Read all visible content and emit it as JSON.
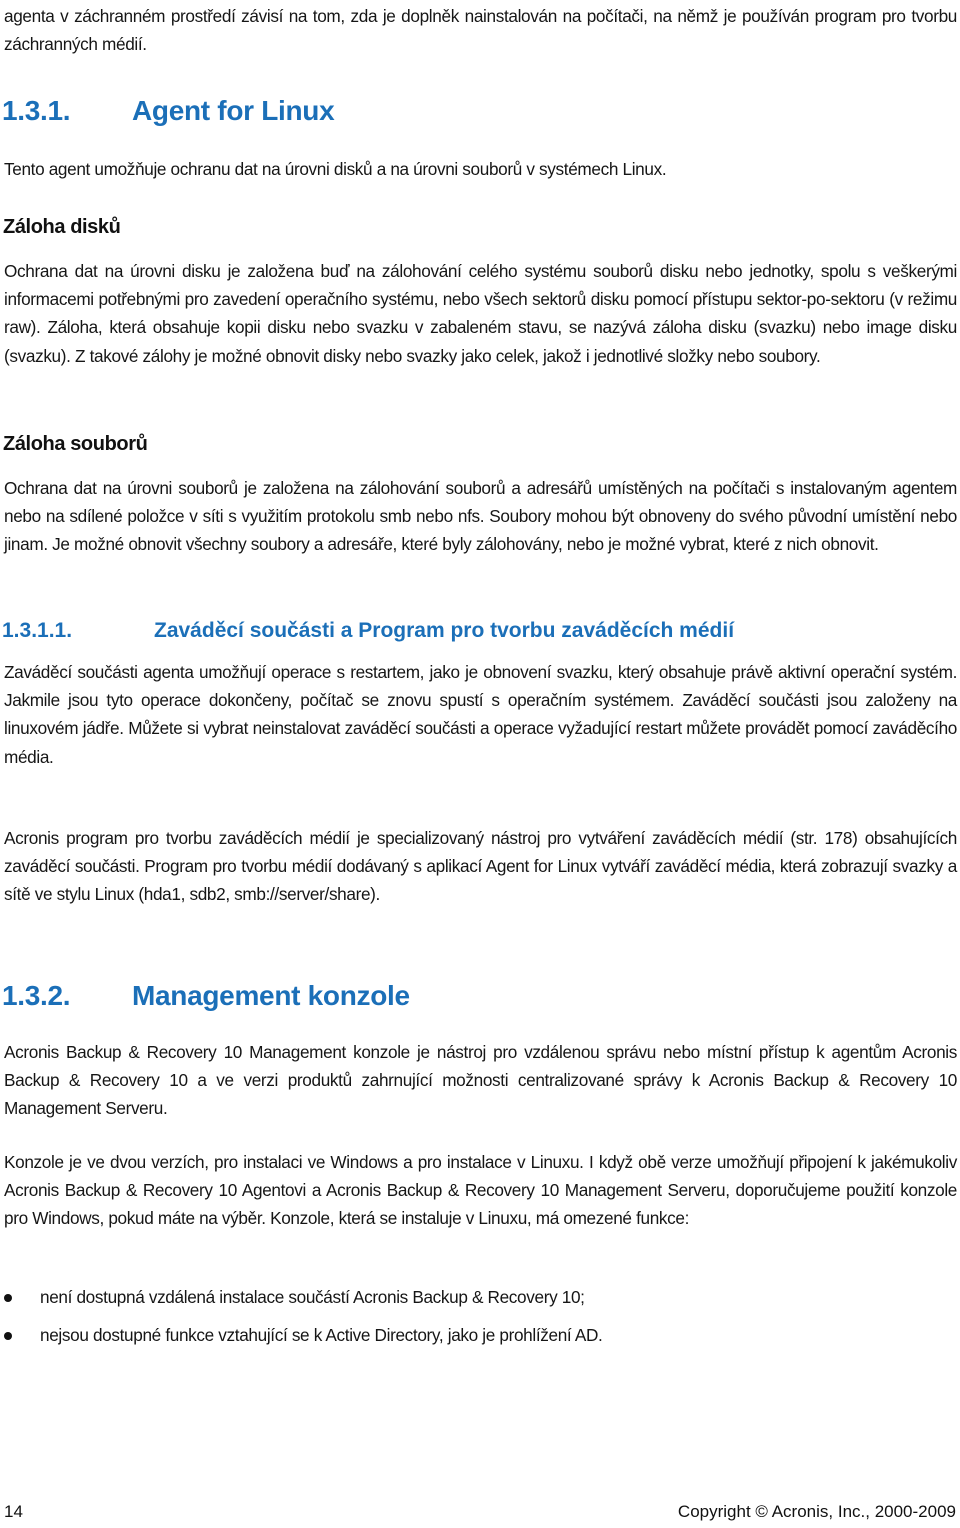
{
  "document": {
    "intro_paragraph": "agenta v záchranném prostředí závisí na tom, zda je doplněk nainstalován na počítači, na němž je používán program pro tvorbu záchranných médií.",
    "section_131": {
      "number": "1.3.1.",
      "title": "Agent for Linux",
      "intro": "Tento agent umožňuje ochranu dat na úrovni disků a na úrovni souborů v systémech Linux.",
      "disk_backup": {
        "heading": "Záloha disků",
        "text": "Ochrana dat na úrovni disku je založena buď na zálohování celého systému souborů disku nebo jednotky, spolu s veškerými informacemi potřebnými pro zavedení operačního systému, nebo všech sektorů disku pomocí přístupu sektor-po-sektoru (v režimu raw). Záloha, která obsahuje kopii disku nebo svazku v zabaleném stavu, se nazývá záloha disku (svazku) nebo image disku (svazku). Z takové zálohy je možné obnovit disky nebo svazky jako celek, jakož i jednotlivé složky nebo soubory."
      },
      "file_backup": {
        "heading": "Záloha souborů",
        "text": "Ochrana dat na úrovni souborů je založena na zálohování souborů a adresářů umístěných na počítači s instalovaným agentem nebo na sdílené položce v síti s využitím protokolu smb nebo nfs. Soubory mohou být obnoveny do svého původní umístění nebo jinam. Je možné obnovit všechny soubory a adresáře, které byly zálohovány, nebo je možné vybrat, které z nich obnovit."
      }
    },
    "section_1311": {
      "number": "1.3.1.1.",
      "title": "Zaváděcí součásti a Program pro tvorbu zaváděcích médií",
      "paragraph_1": "Zaváděcí součásti agenta umožňují operace s restartem, jako je obnovení svazku, který obsahuje právě aktivní operační systém. Jakmile jsou tyto operace dokončeny, počítač se znovu spustí s operačním systémem. Zaváděcí součásti jsou založeny na linuxovém jádře. Můžete si vybrat neinstalovat zaváděcí součásti a operace vyžadující restart můžete provádět pomocí zaváděcího média.",
      "paragraph_2": "Acronis program pro tvorbu zaváděcích médií je specializovaný nástroj pro vytváření zaváděcích médií (str.  178) obsahujících zaváděcí součásti. Program pro tvorbu médií dodávaný s aplikací Agent for Linux vytváří zaváděcí média, která zobrazují svazky a sítě ve stylu Linux (hda1, sdb2, smb://server/share)."
    },
    "section_132": {
      "number": "1.3.2.",
      "title": "Management konzole",
      "paragraph_1": "Acronis Backup & Recovery 10 Management konzole je nástroj pro vzdálenou správu nebo místní přístup k agentům Acronis Backup & Recovery 10 a ve verzi produktů zahrnující možnosti centralizované správy k Acronis Backup & Recovery 10 Management Serveru.",
      "paragraph_2": "Konzole je ve dvou verzích, pro instalaci ve Windows a pro instalace v Linuxu. I když obě verze umožňují připojení k jakémukoliv Acronis Backup & Recovery 10 Agentovi a Acronis Backup & Recovery 10 Management Serveru, doporučujeme použití konzole pro Windows, pokud máte na výběr. Konzole, která se instaluje v Linuxu, má omezené funkce:",
      "bullets": [
        "není dostupná vzdálená instalace součástí Acronis Backup & Recovery 10;",
        "nejsou dostupné funkce vztahující se k Active Directory, jako je prohlížení AD."
      ]
    }
  },
  "footer": {
    "page_number": "14",
    "copyright": "Copyright © Acronis, Inc., 2000-2009"
  },
  "colors": {
    "heading_blue": "#1b6fb8",
    "text": "#161616"
  }
}
